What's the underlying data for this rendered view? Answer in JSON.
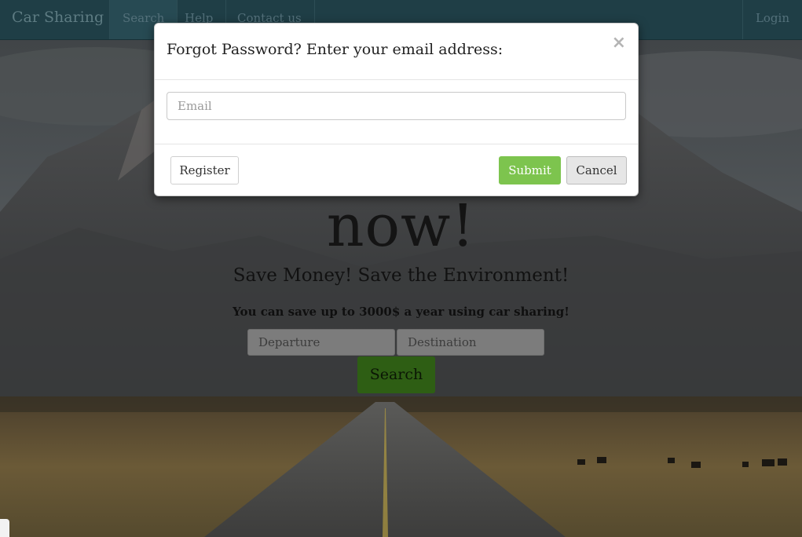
{
  "navbar": {
    "brand": "Car Sharing",
    "items": [
      {
        "label": "Search"
      },
      {
        "label": "Help"
      },
      {
        "label": "Contact us"
      }
    ],
    "login_label": "Login"
  },
  "hero": {
    "title": "now!",
    "subtitle": "Save Money! Save the Environment!",
    "note": "You can save up to 3000$ a year using car sharing!",
    "departure_placeholder": "Departure",
    "destination_placeholder": "Destination",
    "search_label": "Search"
  },
  "modal": {
    "title": "Forgot Password? Enter your email address:",
    "close_symbol": "×",
    "email_placeholder": "Email",
    "register_label": "Register",
    "submit_label": "Submit",
    "cancel_label": "Cancel"
  },
  "colors": {
    "navbar_bg": "#1f3e46",
    "submit_green": "#7dc44e",
    "search_green": "#2e5e14"
  }
}
